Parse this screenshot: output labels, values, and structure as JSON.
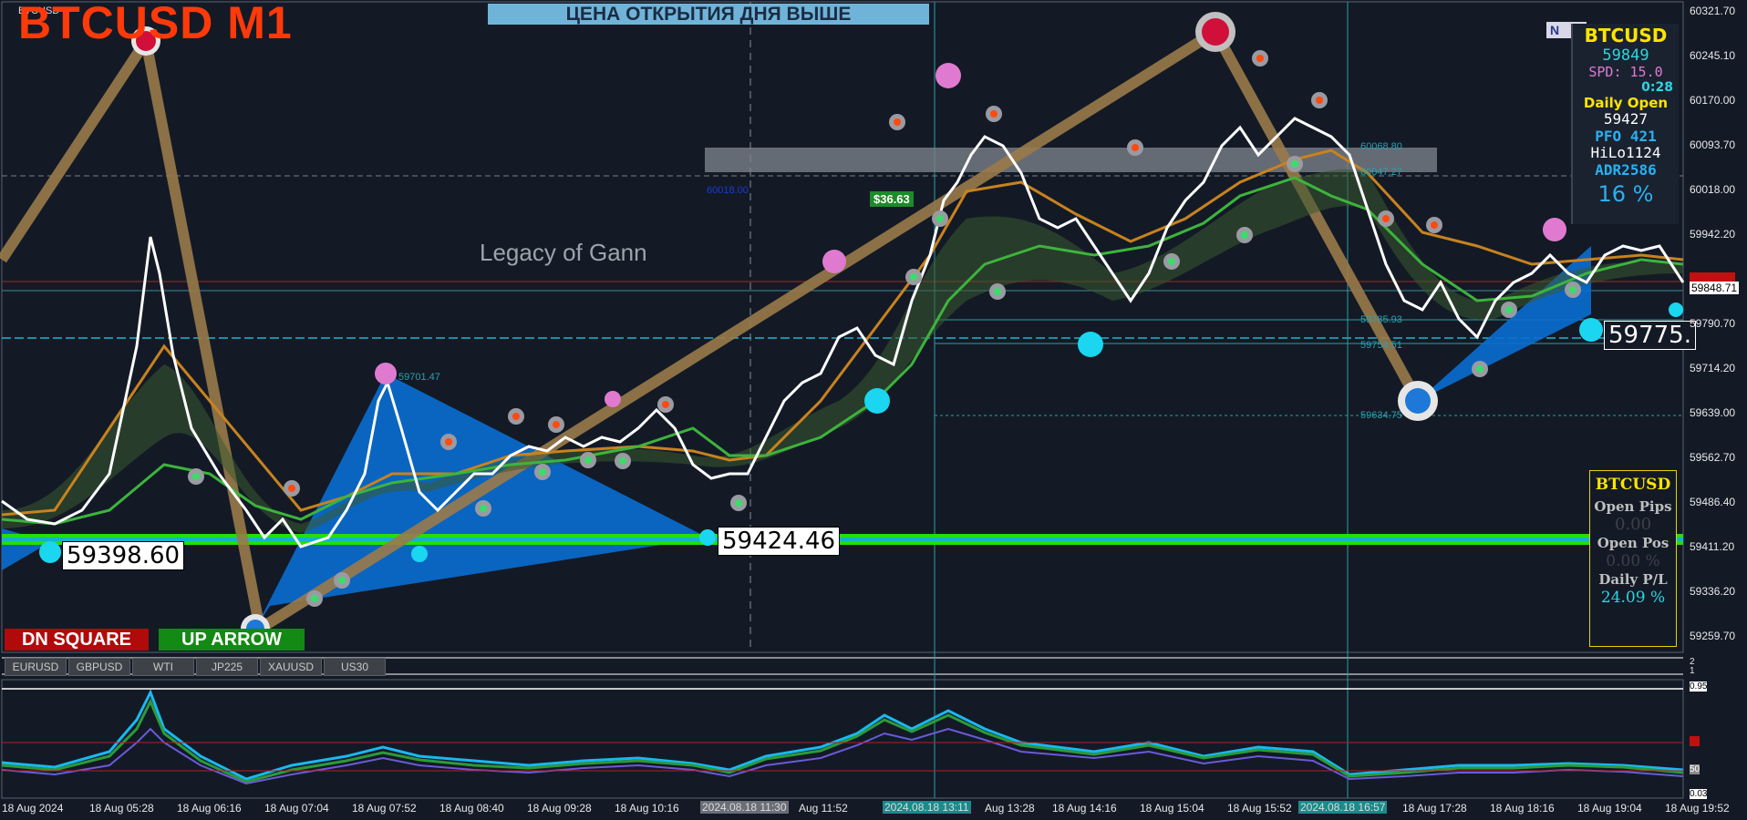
{
  "header": {
    "symbol_small": "BTCUSD",
    "title": "BTCUSD M1",
    "banner": "ЦЕНА ОТКРЫТИЯ ДНЯ ВЫШЕ",
    "watermark": "Legacy of Gann",
    "n_box": "N"
  },
  "price_labels": {
    "left_low": "59398.60",
    "mid_low": "59424.46",
    "right_current": "59775.",
    "profit_tag": "$36.63"
  },
  "small_tags": {
    "t1": "59701.47",
    "t2": "60018.00",
    "t3": "60068.80",
    "t4": "60047.27",
    "t5": "59785.93",
    "t6": "59754.51",
    "t7": "59634.75"
  },
  "signal_buttons": {
    "dn_square": "DN SQUARE",
    "up_arrow": "UP ARROW"
  },
  "symbol_tabs": [
    "EURUSD",
    "GBPUSD",
    "WTI",
    "JP225",
    "XAUUSD",
    "US30"
  ],
  "info_panel": {
    "symbol": "BTCUSD",
    "price": "59849",
    "spread": "SPD: 15.0",
    "timer": "0:28",
    "daily_open_label": "Daily Open",
    "daily_open_value": "59427",
    "pfo": "PFO  421",
    "hilo": "HiLo1124",
    "adr": "ADR2586",
    "adr_pct": "16 %"
  },
  "account_panel": {
    "symbol": "BTCUSD",
    "open_pips_label": "Open Pips",
    "open_pips_value": "0.00",
    "open_pos_label": "Open Pos",
    "open_pos_value": "0.00 %",
    "daily_pl_label": "Daily P/L",
    "daily_pl_value": "24.09 %"
  },
  "y_axis": {
    "labels": [
      "60321.70",
      "60245.10",
      "60170.00",
      "60093.70",
      "60018.00",
      "59942.20",
      "59866.71",
      "59790.70",
      "59714.20",
      "59639.00",
      "59562.70",
      "59486.40",
      "59411.20",
      "59336.20",
      "59259.70"
    ],
    "current_price": "59848.71",
    "red_tag": "59863.71",
    "osc_labels": [
      "2",
      "1",
      "0.95",
      "30",
      "50",
      "0.03"
    ]
  },
  "x_axis": {
    "labels": [
      "18 Aug 2024",
      "18 Aug 05:28",
      "18 Aug 06:16",
      "18 Aug 07:04",
      "18 Aug 07:52",
      "18 Aug 08:40",
      "18 Aug 09:28",
      "18 Aug 10:16",
      "Aug 11:52",
      "Aug 13:28",
      "18 Aug 14:16",
      "18 Aug 15:04",
      "18 Aug 15:52",
      "18 Aug 17:28",
      "18 Aug 18:16",
      "18 Aug 19:04",
      "18 Aug 19:52"
    ],
    "highlights": [
      "2024.08.18 11:30",
      "2024.08.18 13:11",
      "2024.08.18 16:57"
    ]
  },
  "colors": {
    "background": "#131a26",
    "title": "#ff3a0a",
    "banner": "#6fb4d8",
    "white_line": "#ffffff",
    "green_ma": "#3cb43c",
    "orange_ma": "#c8821e",
    "blue_fill": "#0a6ed2",
    "gann_line": "#9a7a4a",
    "green_band": "#22e000"
  }
}
